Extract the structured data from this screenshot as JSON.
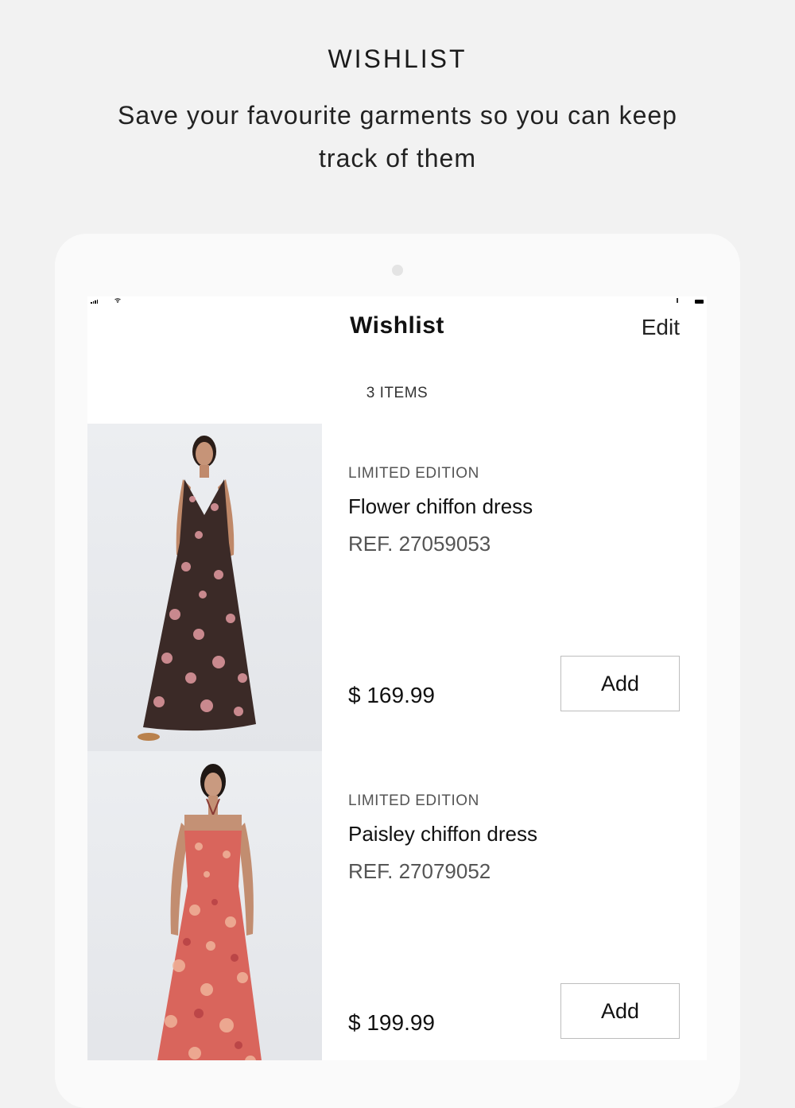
{
  "promo": {
    "title": "WISHLIST",
    "subtitle": "Save your favourite garments so you can keep track of them"
  },
  "nav": {
    "title": "Wishlist",
    "edit_label": "Edit"
  },
  "items_count": "3 ITEMS",
  "products": [
    {
      "badge": "LIMITED EDITION",
      "name": "Flower chiffon dress",
      "ref": "REF. 27059053",
      "price": "$ 169.99",
      "add_label": "Add",
      "image_icon": "model-flower-dress-photo",
      "dress_color": "#3b2a27",
      "print_color": "#d9949a"
    },
    {
      "badge": "LIMITED EDITION",
      "name": "Paisley chiffon dress",
      "ref": "REF. 27079052",
      "price": "$ 199.99",
      "add_label": "Add",
      "image_icon": "model-paisley-dress-photo",
      "dress_color": "#d9655c",
      "print_color": "#f0b39a"
    }
  ]
}
